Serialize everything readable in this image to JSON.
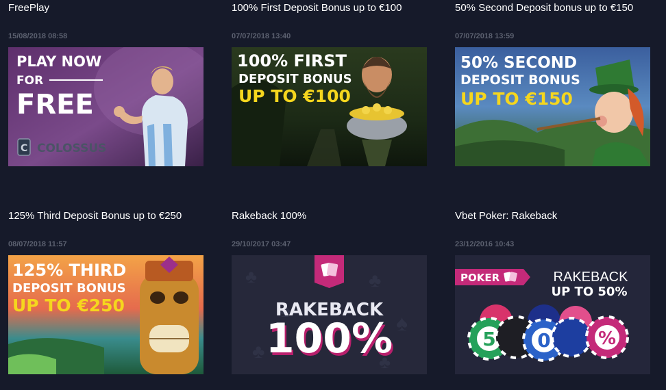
{
  "colors": {
    "background": "#161a2a",
    "date_text": "#5c6170",
    "promo_yellow": "#f5d61e",
    "poker_pink": "#c42a79"
  },
  "promotions": [
    {
      "title": "FreePlay",
      "date": "15/08/2018 08:58",
      "banner": {
        "line1": "PLAY NOW",
        "line2": "FOR",
        "line3": "FREE",
        "brand": "COLOSSUS",
        "brand_mark": "C"
      }
    },
    {
      "title": "100% First Deposit Bonus up to €100",
      "date": "07/07/2018 13:40",
      "banner": {
        "line1": "100% FIRST",
        "line2": "DEPOSIT BONUS",
        "line3": "UP TO €100"
      }
    },
    {
      "title": "50% Second Deposit bonus up to €150",
      "date": "07/07/2018 13:59",
      "banner": {
        "line1": "50% SECOND",
        "line2": "DEPOSIT BONUS",
        "line3": "UP TO €150"
      }
    },
    {
      "title": "125% Third Deposit Bonus up to €250",
      "date": "08/07/2018 11:57",
      "banner": {
        "line1": "125% THIRD",
        "line2": "DEPOSIT BONUS",
        "line3": "UP TO €250"
      }
    },
    {
      "title": "Rakeback 100%",
      "date": "29/10/2017 03:47",
      "banner": {
        "line1": "RAKEBACK",
        "line2": "100%"
      }
    },
    {
      "title": "Vbet Poker: Rakeback",
      "date": "23/12/2016 10:43",
      "banner": {
        "tag": "POKER",
        "line1": "RAKEBACK",
        "line2": "UP TO 50%",
        "chip1": "5",
        "chip2": "0",
        "chip3": "%"
      }
    }
  ]
}
